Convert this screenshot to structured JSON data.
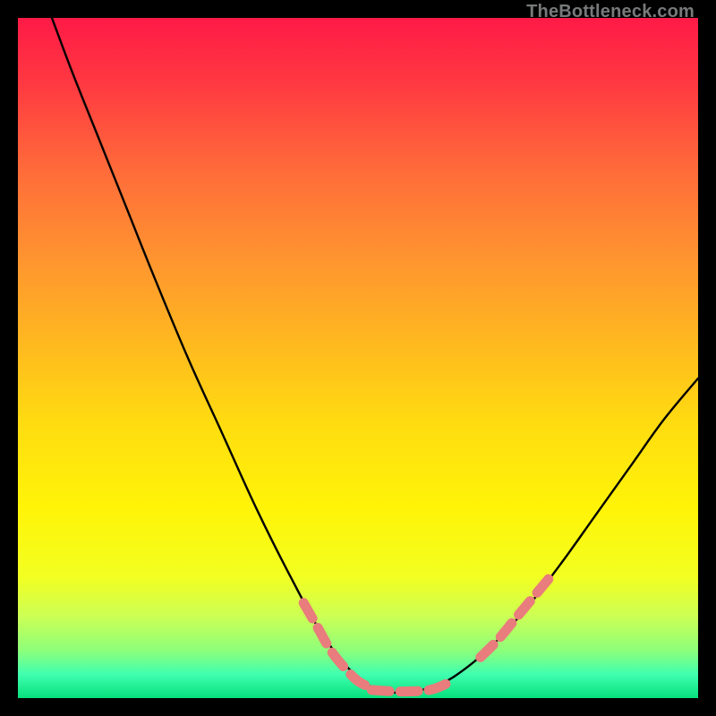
{
  "watermark": "TheBottleneck.com",
  "chart_data": {
    "type": "line",
    "title": "",
    "xlabel": "",
    "ylabel": "",
    "xlim": [
      0,
      100
    ],
    "ylim": [
      0,
      100
    ],
    "grid": false,
    "legend": false,
    "gradient_stops": [
      {
        "pos": 0.0,
        "color": "#ff1a47"
      },
      {
        "pos": 0.1,
        "color": "#ff3a41"
      },
      {
        "pos": 0.22,
        "color": "#ff6a3a"
      },
      {
        "pos": 0.35,
        "color": "#ff9330"
      },
      {
        "pos": 0.48,
        "color": "#ffb91f"
      },
      {
        "pos": 0.6,
        "color": "#ffdd10"
      },
      {
        "pos": 0.72,
        "color": "#fff408"
      },
      {
        "pos": 0.82,
        "color": "#f3ff20"
      },
      {
        "pos": 0.88,
        "color": "#ccff55"
      },
      {
        "pos": 0.93,
        "color": "#8dff7a"
      },
      {
        "pos": 0.965,
        "color": "#40ffb0"
      },
      {
        "pos": 1.0,
        "color": "#06e07c"
      }
    ],
    "series": [
      {
        "name": "bottleneck-curve",
        "style": "solid-black",
        "points": [
          {
            "x": 5.0,
            "y": 100.0
          },
          {
            "x": 8.0,
            "y": 92.0
          },
          {
            "x": 12.0,
            "y": 82.0
          },
          {
            "x": 16.0,
            "y": 72.0
          },
          {
            "x": 20.0,
            "y": 62.0
          },
          {
            "x": 25.0,
            "y": 50.0
          },
          {
            "x": 30.0,
            "y": 39.0
          },
          {
            "x": 35.0,
            "y": 28.0
          },
          {
            "x": 40.0,
            "y": 18.0
          },
          {
            "x": 45.0,
            "y": 9.0
          },
          {
            "x": 50.0,
            "y": 3.0
          },
          {
            "x": 54.0,
            "y": 1.0
          },
          {
            "x": 58.0,
            "y": 1.0
          },
          {
            "x": 62.0,
            "y": 2.0
          },
          {
            "x": 66.0,
            "y": 4.5
          },
          {
            "x": 70.0,
            "y": 8.0
          },
          {
            "x": 75.0,
            "y": 13.5
          },
          {
            "x": 80.0,
            "y": 20.0
          },
          {
            "x": 85.0,
            "y": 27.0
          },
          {
            "x": 90.0,
            "y": 34.0
          },
          {
            "x": 95.0,
            "y": 41.0
          },
          {
            "x": 100.0,
            "y": 47.0
          }
        ]
      },
      {
        "name": "marker-band-left",
        "style": "dashed-salmon",
        "points": [
          {
            "x": 42.0,
            "y": 14.0
          },
          {
            "x": 44.0,
            "y": 10.5
          },
          {
            "x": 46.0,
            "y": 7.0
          },
          {
            "x": 48.0,
            "y": 4.5
          },
          {
            "x": 50.0,
            "y": 2.5
          },
          {
            "x": 52.0,
            "y": 1.5
          }
        ]
      },
      {
        "name": "marker-band-bottom",
        "style": "dashed-salmon",
        "points": [
          {
            "x": 52.0,
            "y": 1.2
          },
          {
            "x": 55.0,
            "y": 1.0
          },
          {
            "x": 58.0,
            "y": 1.0
          },
          {
            "x": 61.0,
            "y": 1.3
          },
          {
            "x": 64.0,
            "y": 2.6
          }
        ]
      },
      {
        "name": "marker-band-right",
        "style": "dashed-salmon",
        "points": [
          {
            "x": 68.0,
            "y": 6.0
          },
          {
            "x": 70.5,
            "y": 8.5
          },
          {
            "x": 73.0,
            "y": 11.5
          },
          {
            "x": 75.5,
            "y": 14.5
          },
          {
            "x": 78.0,
            "y": 17.5
          }
        ]
      }
    ]
  }
}
